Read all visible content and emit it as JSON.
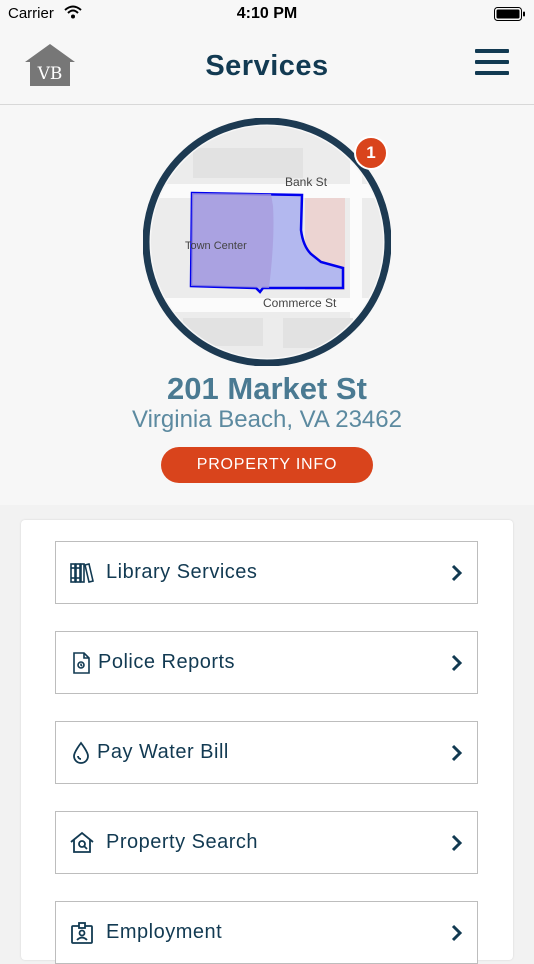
{
  "status_bar": {
    "carrier": "Carrier",
    "time": "4:10 PM"
  },
  "header": {
    "logo_text": "VB",
    "title": "Services",
    "menu_icon": "hamburger-menu-icon"
  },
  "property": {
    "notification_count": "1",
    "map_labels": {
      "street_top": "Bank St",
      "area": "Town Center",
      "street_bottom": "Commerce St"
    },
    "address": "201 Market St",
    "city": "Virginia Beach, VA 23462",
    "info_button": "PROPERTY INFO"
  },
  "services": [
    {
      "label": "Library Services",
      "icon": "books-icon"
    },
    {
      "label": "Police Reports",
      "icon": "document-icon"
    },
    {
      "label": "Pay Water Bill",
      "icon": "water-drop-icon"
    },
    {
      "label": "Property Search",
      "icon": "house-search-icon"
    },
    {
      "label": "Employment",
      "icon": "id-badge-icon"
    }
  ],
  "colors": {
    "brand": "#123a52",
    "accent": "#d9441c",
    "address": "#4a7a92"
  }
}
